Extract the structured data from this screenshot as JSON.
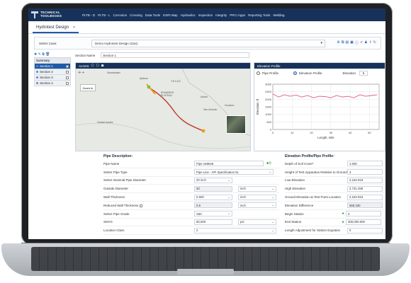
{
  "app": {
    "logo_line1": "TECHNICAL",
    "logo_line2": "TOOLBOXES",
    "menu": [
      "PLTB - D",
      "PLTB - L",
      "Corrosion",
      "Crossing",
      "Data Tools",
      "ESRI Map",
      "Hydraulics",
      "Inspection",
      "Integrity",
      "PRCI Apps",
      "Reporting Tools",
      "Welding"
    ]
  },
  "tab": {
    "label": "Hydrotest Design",
    "close": "×"
  },
  "case": {
    "label": "Select Case:",
    "value": "Demo Hydrotest Design (Gas)"
  },
  "tree": {
    "header": "Summary",
    "items": [
      "Section 1",
      "Section 2",
      "Section 3",
      "Section 4"
    ]
  },
  "section": {
    "label": "Section Name",
    "value": "Section 1"
  },
  "map": {
    "title": "ArcGIS",
    "zoom_label": "Zoom In",
    "labels": {
      "l1": "Sweetwater",
      "l2": "Abilene",
      "l3": "TEXAS",
      "l4": "EDWARDS PLATEAU",
      "l5": "Austin",
      "l6": "Houston",
      "l7": "San Antonio",
      "l8": "Ciudad Acuña"
    }
  },
  "elevation": {
    "title": "Elevation Profile",
    "pipe_profile": "Pipe Profile",
    "elevation_profile": "Elevation Profile",
    "elevation_label": "Elevation",
    "elevation_value": "5"
  },
  "chart_data": {
    "type": "line",
    "xlabel": "Length, mile",
    "ylabel": "Elevation, ft",
    "xlim": [
      0,
      55
    ],
    "ylim": [
      0,
      3000
    ],
    "x_ticks": [
      0,
      10,
      20,
      30,
      40,
      50
    ],
    "y_ticks": [
      0,
      500,
      1000,
      1500,
      2000,
      2500,
      3000
    ],
    "series": [
      {
        "x": [
          0,
          3,
          6,
          9,
          12,
          15,
          18,
          21,
          24,
          27,
          30,
          33,
          36,
          39,
          42,
          45,
          48,
          51,
          54
        ],
        "values": [
          2350,
          2150,
          2300,
          2200,
          2280,
          2150,
          2250,
          2100,
          2200,
          2180,
          2100,
          2250,
          2150,
          2200,
          2100,
          2300,
          2200,
          2250,
          2300
        ]
      }
    ]
  },
  "pipe": {
    "title": "Pipe Description:",
    "rows": [
      {
        "label": "Pipe Name",
        "value": "Pipe 168545"
      },
      {
        "label": "Select Pipe Type",
        "value": "Pipe Line - API Specification 5L"
      },
      {
        "label": "Select Nominal Pipe Diameter",
        "value": "20 inch"
      },
      {
        "label": "Outside Diameter",
        "value": "20",
        "unit": "inch"
      },
      {
        "label": "Wall Thickness",
        "value": "0.500",
        "unit": "inch"
      },
      {
        "label": "Reduced Wall Thickness",
        "value": "0.5",
        "unit": "inch"
      },
      {
        "label": "Select Pipe Grade",
        "value": "X60"
      },
      {
        "label": "SMYS",
        "value": "60,000",
        "unit": "psi"
      },
      {
        "label": "Location Class",
        "value": "2"
      }
    ]
  },
  "profile": {
    "title": "Elevation Profile/Pipe Profile:",
    "rows": [
      {
        "label": "Depth of Soil Cover*",
        "value": "4.000"
      },
      {
        "label": "Height of Test Apparatus Relative to Ground",
        "value": "3"
      },
      {
        "label": "Low Elevation",
        "value": "2,162.919"
      },
      {
        "label": "High Elevation",
        "value": "2,731.259"
      },
      {
        "label": "Ground Elevation at Test Point Location",
        "value": "2,162.919"
      },
      {
        "label": "Elevation Difference",
        "value": "568.330"
      },
      {
        "label": "Begin Station",
        "value": "0"
      },
      {
        "label": "End Station",
        "value": "300,000.000"
      },
      {
        "label": "Length Adjustment for Station Equation",
        "value": "0"
      }
    ]
  }
}
